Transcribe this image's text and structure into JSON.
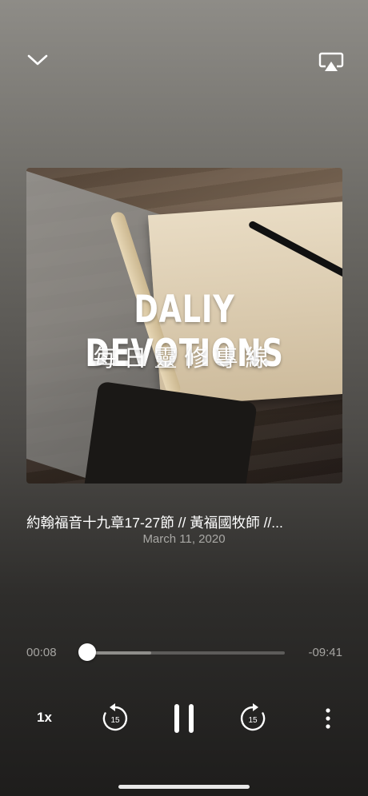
{
  "header": {
    "collapse_icon": "chevron-down-icon",
    "airplay_icon": "airplay-icon"
  },
  "artwork": {
    "title": "DALIY DEVOTIONS",
    "subtitle": "每日靈修專線"
  },
  "episode": {
    "title": "約翰福音十九章17-27節 // 黃福國牧師 //...",
    "date": "March 11, 2020"
  },
  "player": {
    "elapsed": "00:08",
    "remaining": "-09:41",
    "progress_fraction": 0.01,
    "buffered_fraction": 0.33,
    "speed": "1x",
    "skip_back_seconds": "15",
    "skip_forward_seconds": "15",
    "state": "playing"
  },
  "colors": {
    "accent": "#ffffff",
    "muted_text": "#a5a4a1"
  }
}
